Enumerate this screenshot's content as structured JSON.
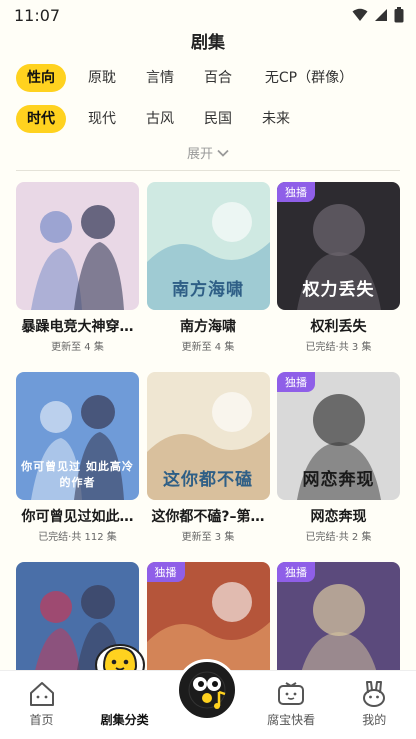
{
  "status_bar": {
    "time": "11:07"
  },
  "page_title": "剧集",
  "genre_filters": [
    "性向",
    "原耽",
    "言情",
    "百合",
    "无CP（群像）"
  ],
  "genre_selected": 0,
  "era_filters": [
    "时代",
    "现代",
    "古风",
    "民国",
    "未来"
  ],
  "era_selected": 0,
  "expand_label": "展开",
  "cards": [
    {
      "title": "暴躁电竞大神穿…",
      "status": "更新至 4 集",
      "badge": "",
      "cover_text": "",
      "colors": {
        "bg": "#e9d8e6",
        "accent": "#7b8fc9"
      }
    },
    {
      "title": "南方海啸",
      "status": "更新至 4 集",
      "badge": "",
      "cover_text": "南方海啸",
      "colors": {
        "bg": "#cfe9e2",
        "accent": "#7fb7c9"
      }
    },
    {
      "title": "权利丢失",
      "status": "已完结·共 3 集",
      "badge": "独播",
      "cover_text": "权力丢失",
      "colors": {
        "bg": "#2d2b30",
        "accent": "#6d6870"
      }
    },
    {
      "title": "你可曾见过如此…",
      "status": "已完结·共 112 集",
      "badge": "",
      "cover_text": "你可曾见过 如此高冷的作者",
      "colors": {
        "bg": "#6f9bd8",
        "accent": "#dbe7f7"
      }
    },
    {
      "title": "这你都不磕?–第…",
      "status": "更新至 3 集",
      "badge": "",
      "cover_text": "这你都不磕",
      "colors": {
        "bg": "#efe6d2",
        "accent": "#c9a77a"
      }
    },
    {
      "title": "网恋奔现",
      "status": "已完结·共 2 集",
      "badge": "独播",
      "cover_text": "网恋奔现",
      "colors": {
        "bg": "#d9d9d9",
        "accent": "#3a3a3a"
      }
    },
    {
      "title": "",
      "status": "",
      "badge": "",
      "cover_text": "",
      "colors": {
        "bg": "#4a6fa8",
        "accent": "#c23b5a"
      }
    },
    {
      "title": "",
      "status": "",
      "badge": "独播",
      "cover_text": "",
      "colors": {
        "bg": "#b5553a",
        "accent": "#e8a46a"
      }
    },
    {
      "title": "",
      "status": "",
      "badge": "独播",
      "cover_text": "",
      "colors": {
        "bg": "#5b4a7c",
        "accent": "#d9c8a0"
      }
    }
  ],
  "bottom_nav": [
    {
      "label": "首页",
      "icon": "house-icon"
    },
    {
      "label": "剧集分类",
      "icon": "mascot-icon"
    },
    {
      "label": "",
      "icon": "music-disc-icon"
    },
    {
      "label": "腐宝快看",
      "icon": "tv-face-icon"
    },
    {
      "label": "我的",
      "icon": "bunny-face-icon"
    }
  ],
  "bottom_nav_selected": 1,
  "colors": {
    "accent": "#ffd21f",
    "badge": "#8f5fe8",
    "background": "#fffef7"
  }
}
